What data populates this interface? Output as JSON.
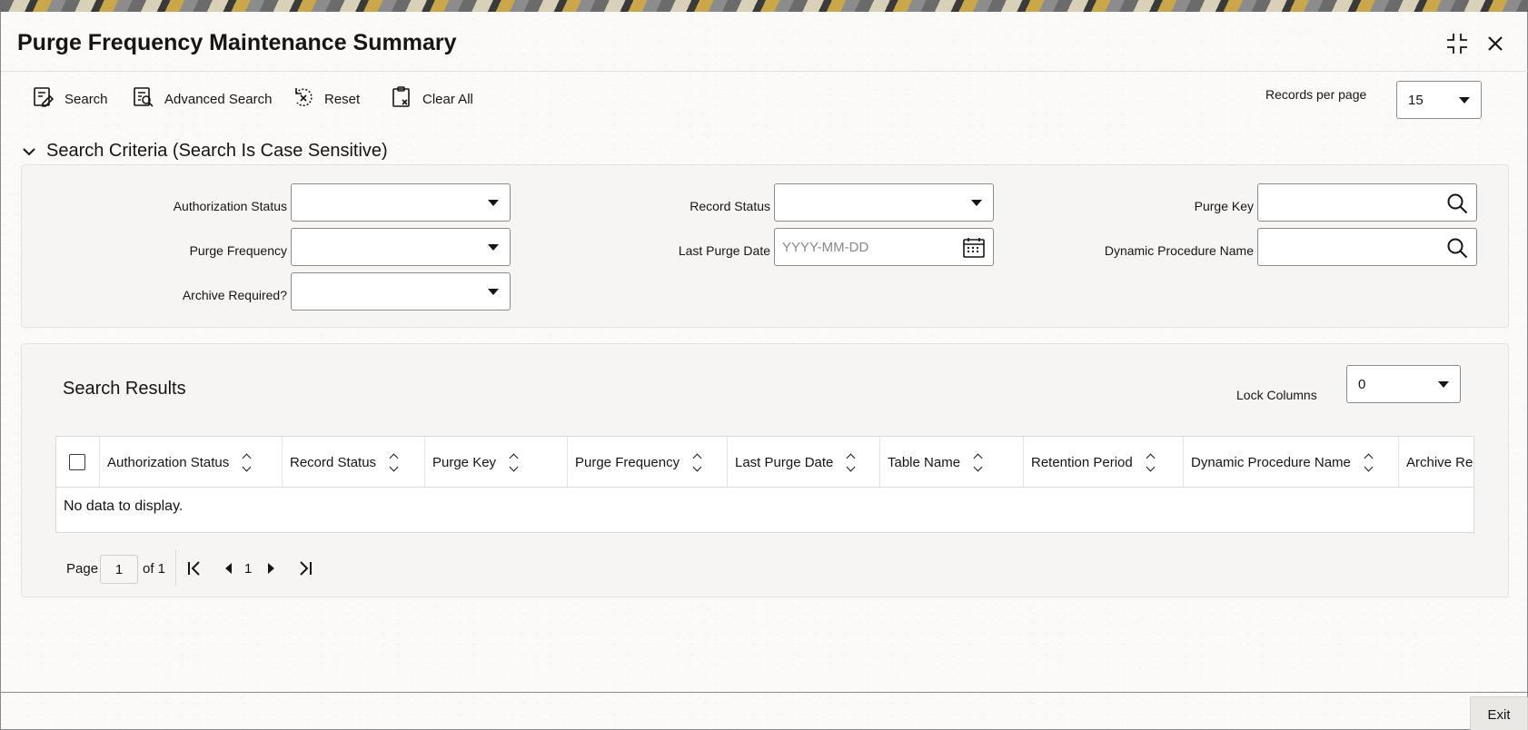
{
  "window": {
    "title": "Purge Frequency Maintenance Summary"
  },
  "toolbar": {
    "search_label": "Search",
    "advanced_search_label": "Advanced Search",
    "reset_label": "Reset",
    "clear_all_label": "Clear All",
    "records_per_page_label": "Records per page",
    "records_per_page_value": "15"
  },
  "search_criteria": {
    "header": "Search Criteria (Search Is Case Sensitive)",
    "fields": {
      "authorization_status": {
        "label": "Authorization Status",
        "value": ""
      },
      "record_status": {
        "label": "Record Status",
        "value": ""
      },
      "purge_key": {
        "label": "Purge Key",
        "value": ""
      },
      "purge_frequency": {
        "label": "Purge Frequency",
        "value": ""
      },
      "last_purge_date": {
        "label": "Last Purge Date",
        "value": "",
        "placeholder": "YYYY-MM-DD"
      },
      "dynamic_procedure_name": {
        "label": "Dynamic Procedure Name",
        "value": ""
      },
      "archive_required": {
        "label": "Archive Required?",
        "value": ""
      }
    }
  },
  "results": {
    "title": "Search Results",
    "lock_columns_label": "Lock Columns",
    "lock_columns_value": "0",
    "columns": [
      "Authorization Status",
      "Record Status",
      "Purge Key",
      "Purge Frequency",
      "Last Purge Date",
      "Table Name",
      "Retention Period",
      "Dynamic Procedure Name",
      "Archive Re"
    ],
    "empty_message": "No data to display."
  },
  "pagination": {
    "page_label": "Page",
    "current_page": "1",
    "of_label": "of 1",
    "page_number": "1"
  },
  "footer": {
    "exit_label": "Exit"
  },
  "icons": {
    "search": "search-icon",
    "advanced_search": "advanced-search-icon",
    "reset": "reset-icon",
    "clear_all": "clipboard-clear-icon",
    "maximize": "maximize-icon",
    "close": "close-icon",
    "calendar": "calendar-icon",
    "magnifier": "magnifier-icon"
  }
}
